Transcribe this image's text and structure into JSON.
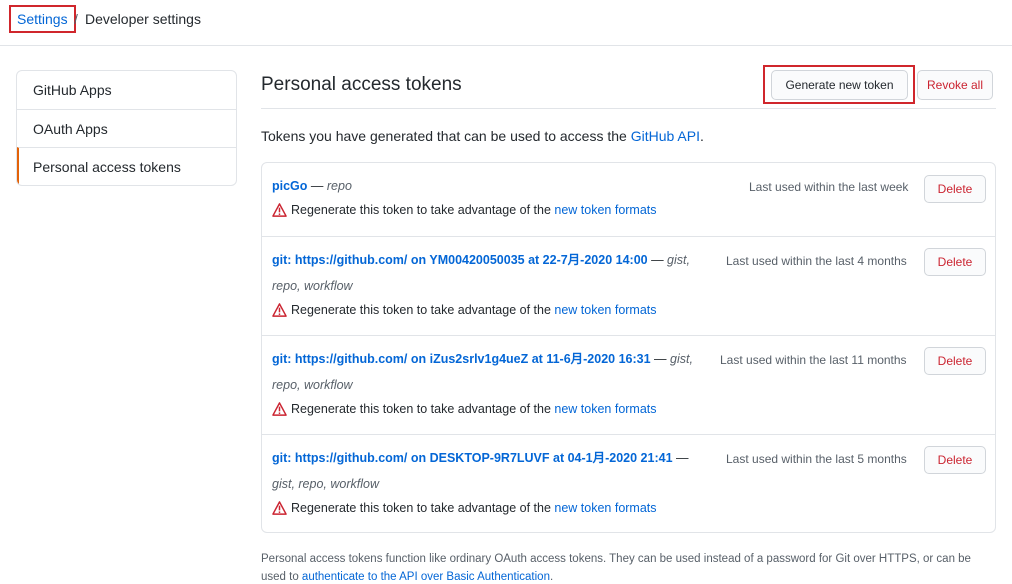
{
  "breadcrumb": {
    "settings": "Settings",
    "separator": "/",
    "current": "Developer settings"
  },
  "sidebar": {
    "items": [
      {
        "label": "GitHub Apps"
      },
      {
        "label": "OAuth Apps"
      },
      {
        "label": "Personal access tokens"
      }
    ]
  },
  "header": {
    "title": "Personal access tokens",
    "generate_label": "Generate new token",
    "revoke_label": "Revoke all"
  },
  "intro": {
    "text": "Tokens you have generated that can be used to access the ",
    "link": "GitHub API",
    "end": "."
  },
  "tokens": [
    {
      "name": "picGo",
      "sep": " — ",
      "scopes": "repo",
      "last_used": "Last used within the last week",
      "delete_label": "Delete",
      "warning_text": "Regenerate this token to take advantage of the ",
      "warning_link": "new token formats"
    },
    {
      "name": "git: https://github.com/ on YM00420050035 at 22-7月-2020 14:00",
      "sep": " — ",
      "scopes": "gist, repo, workflow",
      "last_used": "Last used within the last 4 months",
      "delete_label": "Delete",
      "warning_text": "Regenerate this token to take advantage of the ",
      "warning_link": "new token formats"
    },
    {
      "name": "git: https://github.com/ on iZus2srlv1g4ueZ at 11-6月-2020 16:31",
      "sep": " — ",
      "scopes": "gist, repo, workflow",
      "last_used": "Last used within the last 11 months",
      "delete_label": "Delete",
      "warning_text": "Regenerate this token to take advantage of the ",
      "warning_link": "new token formats"
    },
    {
      "name": "git: https://github.com/ on DESKTOP-9R7LUVF at 04-1月-2020 21:41",
      "sep": " — ",
      "scopes": "gist, repo, workflow",
      "last_used": "Last used within the last 5 months",
      "delete_label": "Delete",
      "warning_text": "Regenerate this token to take advantage of the ",
      "warning_link": "new token formats"
    }
  ],
  "footer": {
    "text": "Personal access tokens function like ordinary OAuth access tokens. They can be used instead of a password for Git over HTTPS, or can be used to ",
    "link": "authenticate to the API over Basic Authentication",
    "end": "."
  },
  "colors": {
    "link": "#0366d6",
    "danger": "#cb2431",
    "highlight": "#d0262c",
    "selected_accent": "#e36209"
  },
  "icons": {
    "warning": "alert-triangle-icon"
  }
}
